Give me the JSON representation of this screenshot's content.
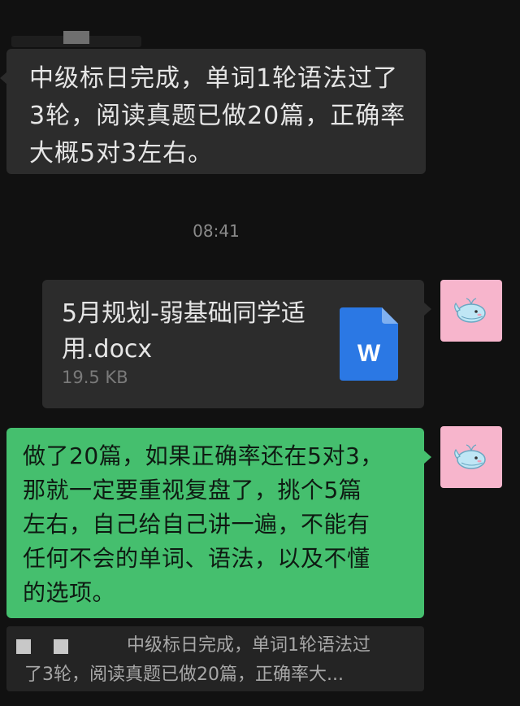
{
  "chat": {
    "incoming_message": "中级标日完成，单词1轮语法过了\n3轮，阅读真题已做20篇，正确率\n大概5对3左右。",
    "timestamp": "08:41",
    "file": {
      "name": "5月规划-弱基础同学适\n用.docx",
      "size": "19.5 KB",
      "icon": "word-document-icon",
      "icon_letter": "W",
      "icon_color": "#2b78e4"
    },
    "outgoing_message": "做了20篇，如果正确率还在5对3，\n那就一定要重视复盘了，挑个5篇\n左右，自己给自己讲一遍，不能有\n任何不会的单词、语法，以及不懂\n的选项。",
    "quote": {
      "line1": "中级标日完成，单词1轮语法过",
      "line2": "了3轮，阅读真题已做20篇，正确率大..."
    }
  },
  "colors": {
    "background": "#111111",
    "incoming_bubble": "#2c2c2c",
    "outgoing_bubble": "#45bf6e",
    "avatar_bg": "#f7b5cc"
  }
}
